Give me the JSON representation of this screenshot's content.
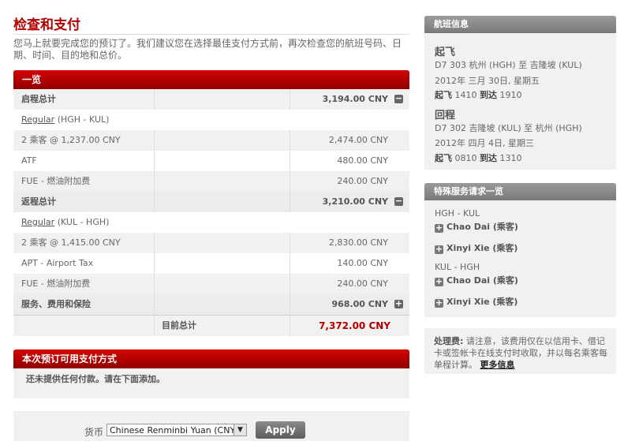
{
  "page": {
    "title": "检查和支付",
    "intro": "您马上就要完成您的预订了。我们建议您在选择最佳支付方式前，再次检查您的航班号码、日期、时间、目的地和总价。"
  },
  "summary": {
    "header": "一览",
    "depart_total_label": "启程总计",
    "depart_total_value": "3,194.00 CNY",
    "depart_fare_link": "Regular",
    "depart_fare_route": " (HGH - KUL)",
    "depart_pax_label": "2 乘客 @ 1,237.00 CNY",
    "depart_pax_value": "2,474.00 CNY",
    "atf_label": "ATF",
    "atf_value": "480.00 CNY",
    "fue1_label": "FUE - 燃油附加费",
    "fue1_value": "240.00 CNY",
    "return_total_label": "返程总计",
    "return_total_value": "3,210.00 CNY",
    "return_fare_link": "Regular",
    "return_fare_route": " (KUL - HGH)",
    "return_pax_label": "2 乘客 @ 1,415.00 CNY",
    "return_pax_value": "2,830.00 CNY",
    "apt_label": "APT - Airport Tax",
    "apt_value": "140.00 CNY",
    "fue2_label": "FUE - 燃油附加费",
    "fue2_value": "240.00 CNY",
    "services_label": "服务、费用和保险",
    "services_value": "968.00 CNY",
    "grand_total_label": "目前总计",
    "grand_total_value": "7,372.00 CNY",
    "minus_symbol": "−",
    "plus_symbol": "+"
  },
  "payment": {
    "header": "本次预订可用支付方式",
    "message": "还未提供任何付款。请在下面添加。"
  },
  "currency": {
    "label": "货币",
    "selected": "Chinese Renminbi Yuan (CNY)",
    "arrow": "▼",
    "apply": "Apply"
  },
  "flight_info": {
    "header": "航班信息",
    "depart_title": "起飞",
    "depart_flight": "D7 303 杭州 (HGH) 至 吉隆坡 (KUL)",
    "depart_date": "2012年 三月 30日, 星期五",
    "depart_dep_label": "起飞",
    "depart_dep_time": " 1410 ",
    "depart_arr_label": "到达",
    "depart_arr_time": " 1910",
    "return_title": "回程",
    "return_flight": "D7 302 吉隆坡 (KUL) 至 杭州 (HGH)",
    "return_date": "2012年 四月 4日, 星期三",
    "return_dep_label": "起飞",
    "return_dep_time": " 0810 ",
    "return_arr_label": "到达",
    "return_arr_time": " 1310"
  },
  "ssr": {
    "header": "特殊服务请求一览",
    "route1": "HGH - KUL",
    "route1_pax1": "Chao Dai (乘客)",
    "route1_pax2": "Xinyi Xie (乘客)",
    "route2": "KUL - HGH",
    "route2_pax1": "Chao Dai (乘客)",
    "route2_pax2": "Xinyi Xie (乘客)",
    "plus_symbol": "+"
  },
  "fee": {
    "label": "处理费:",
    "text": " 请注意，该费用仅在以信用卡、借记卡或签帐卡在线支付时收取，并以每名乘客每单程计算。 ",
    "more_link": "更多信息"
  },
  "colors": {
    "brand_red": "#b00000",
    "panel_grey": "#7a7a7a",
    "row_alt": "#f1f1f1"
  },
  "icons": [
    "minus-toggle-icon",
    "plus-toggle-icon",
    "dropdown-arrow-icon"
  ]
}
